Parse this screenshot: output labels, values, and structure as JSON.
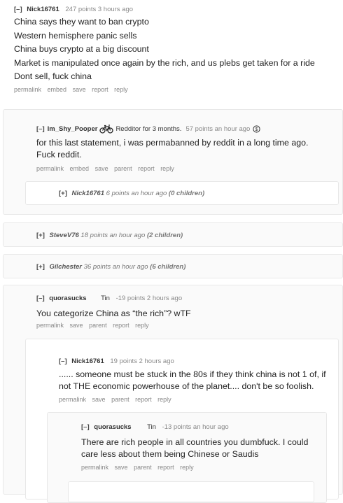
{
  "top": {
    "toggle": "[–]",
    "author": "Nick16761",
    "meta": "247 points 3 hours ago",
    "lines": [
      "China says they want to ban crypto",
      "Western hemisphere panic sells",
      "China buys crypto at a big discount",
      "Market is manipulated once again by the rich, and us plebs get taken for a ride",
      "Dont sell, fuck china"
    ],
    "buttons": [
      "permalink",
      "embed",
      "save",
      "report",
      "reply"
    ]
  },
  "reply1": {
    "toggle": "[–]",
    "author": "Im_Shy_Pooper",
    "flair": "Redditor for 3 months.",
    "meta": "57 points an hour ago",
    "body": "for this last statement, i was permabanned by reddit in a long time ago. Fuck reddit.",
    "buttons": [
      "permalink",
      "embed",
      "save",
      "parent",
      "report",
      "reply"
    ],
    "icons": {
      "flair_icon": "bicycle-icon",
      "award_icon": "coin-icon"
    }
  },
  "collapsed1": {
    "toggle": "[+]",
    "author": "Nick16761",
    "meta": "6 points an hour ago",
    "children": "(0 children)"
  },
  "collapsed2": {
    "toggle": "[+]",
    "author": "SteveV76",
    "meta": "18 points an hour ago",
    "children": "(2 children)"
  },
  "collapsed3": {
    "toggle": "[+]",
    "author": "Gilchester",
    "meta": "36 points an hour ago",
    "children": "(6 children)"
  },
  "reply2": {
    "toggle": "[–]",
    "author": "quorasucks",
    "flair": "Tin",
    "meta": "-19 points 2 hours ago",
    "body": "You categorize China as “the rich”? wTF",
    "buttons": [
      "permalink",
      "save",
      "parent",
      "report",
      "reply"
    ]
  },
  "reply3": {
    "toggle": "[–]",
    "author": "Nick16761",
    "meta": "19 points 2 hours ago",
    "body": "...... someone must be stuck in the 80s if they think china is not 1 of, if not THE economic powerhouse of the planet.... don't be so foolish.",
    "buttons": [
      "permalink",
      "save",
      "parent",
      "report",
      "reply"
    ]
  },
  "reply4": {
    "toggle": "[–]",
    "author": "quorasucks",
    "flair": "Tin",
    "meta": "-13 points an hour ago",
    "body": "There are rich people in all countries you dumbfuck. I could care less about them being Chinese or Saudis",
    "buttons": [
      "permalink",
      "save",
      "parent",
      "report",
      "reply"
    ]
  }
}
